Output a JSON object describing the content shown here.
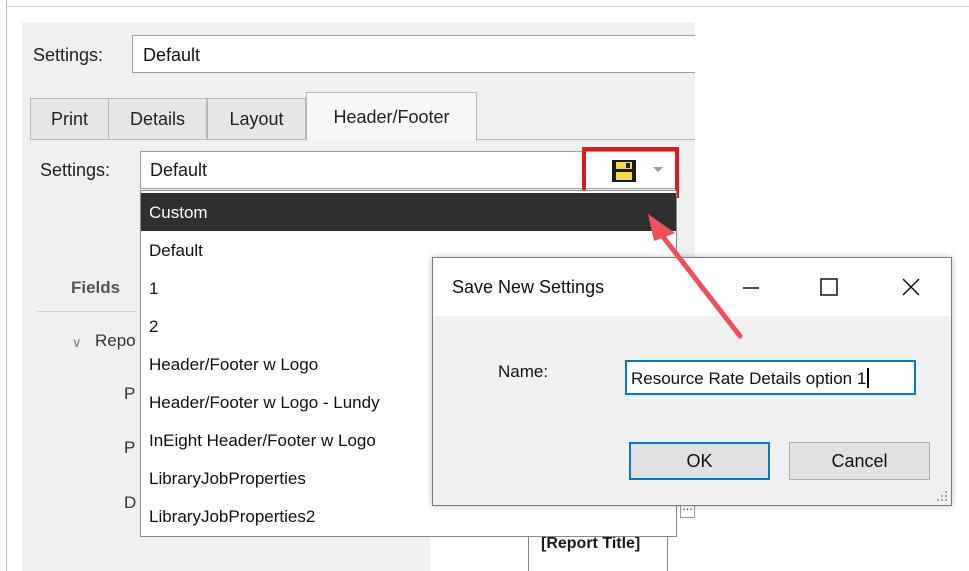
{
  "window": {
    "settings_label": "Settings:",
    "settings_value": "Default"
  },
  "tabs": [
    {
      "label": "Print"
    },
    {
      "label": "Details"
    },
    {
      "label": "Layout"
    },
    {
      "label": "Header/Footer",
      "active": true
    }
  ],
  "header_footer": {
    "settings_label": "Settings:",
    "settings_value": "Default",
    "save_icon": "floppy-disk-icon",
    "dropdown_icon": "chevron-down-icon"
  },
  "dropdown": {
    "items": [
      {
        "label": "Custom",
        "selected": true
      },
      {
        "label": "Default"
      },
      {
        "label": "1"
      },
      {
        "label": "2"
      },
      {
        "label": "Header/Footer w Logo"
      },
      {
        "label": "Header/Footer w Logo - Lundy"
      },
      {
        "label": "InEight Header/Footer w Logo"
      },
      {
        "label": "LibraryJobProperties"
      },
      {
        "label": "LibraryJobProperties2"
      }
    ]
  },
  "background": {
    "fields_label": "Fields",
    "tree_item": "Repo",
    "row1": "P",
    "row2": "P",
    "row3": "D",
    "bottom_box": "[Report Title]"
  },
  "dialog": {
    "title": "Save New Settings",
    "name_label": "Name:",
    "name_value": "Resource Rate Details option 1",
    "ok_label": "OK",
    "cancel_label": "Cancel"
  },
  "colors": {
    "highlight_red": "#e0191e",
    "focus_blue": "#0078d7",
    "selected_bg": "#2f2f2f"
  }
}
